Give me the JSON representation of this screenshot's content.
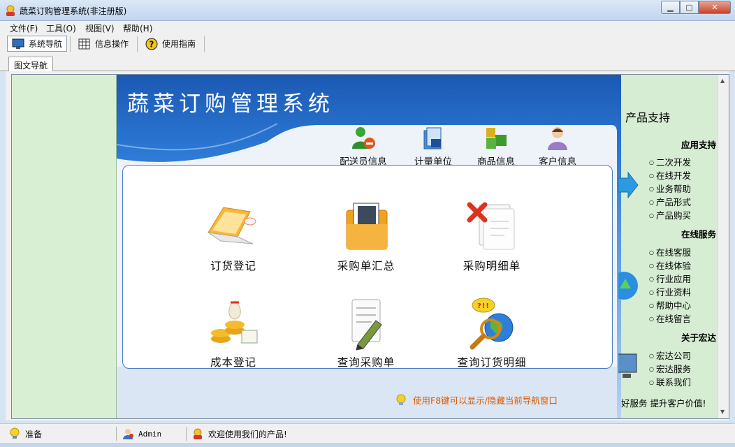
{
  "window": {
    "title": "蔬菜订购管理系统(非注册版)"
  },
  "menu": [
    {
      "label": "文件(F)"
    },
    {
      "label": "工具(O)"
    },
    {
      "label": "视图(V)"
    },
    {
      "label": "帮助(H)"
    }
  ],
  "toolbar": [
    {
      "label": "系统导航",
      "icon": "monitor-icon"
    },
    {
      "label": "信息操作",
      "icon": "grid-icon"
    },
    {
      "label": "使用指南",
      "icon": "help-icon"
    }
  ],
  "doc_tab": {
    "label": "图文导航"
  },
  "banner": {
    "title": "蔬菜订购管理系统"
  },
  "quick_links": [
    {
      "label": "配送员信息",
      "icon": "delivery-person-icon"
    },
    {
      "label": "计量单位",
      "icon": "folder-icon"
    },
    {
      "label": "商品信息",
      "icon": "cubes-icon"
    },
    {
      "label": "客户信息",
      "icon": "customer-icon"
    }
  ],
  "functions": [
    {
      "label": "订货登记",
      "icon": "laptop-icon"
    },
    {
      "label": "采购单汇总",
      "icon": "document-folder-icon"
    },
    {
      "label": "采购明细单",
      "icon": "delete-document-icon"
    },
    {
      "label": "成本登记",
      "icon": "coins-icon"
    },
    {
      "label": "查询采购单",
      "icon": "edit-document-icon"
    },
    {
      "label": "查询订货明细",
      "icon": "search-globe-icon"
    }
  ],
  "hint": {
    "text": "使用F8键可以显示/隐藏当前导航窗口"
  },
  "support": {
    "title": "产品支持",
    "sections": [
      {
        "title": "应用支持",
        "links": [
          "二次开发",
          "在线开发",
          "业务帮助",
          "产品形式",
          "产品购买"
        ]
      },
      {
        "title": "在线服务",
        "links": [
          "在线客服",
          "在线体验",
          "行业应用",
          "行业资料",
          "帮助中心",
          "在线留言"
        ]
      },
      {
        "title": "关于宏达",
        "links": [
          "宏达公司",
          "宏达服务",
          "联系我们"
        ]
      }
    ],
    "slogan": "好服务 提升客户价值!"
  },
  "status": [
    {
      "text": "准备",
      "icon": "lightbulb-icon"
    },
    {
      "text": "Admin",
      "icon": "user-icon"
    },
    {
      "text": "欢迎使用我们的产品!",
      "icon": "app-logo-icon"
    }
  ],
  "colors": {
    "accent": "#2b78d4",
    "hint": "#d65a00",
    "pane": "#d8efd4"
  }
}
